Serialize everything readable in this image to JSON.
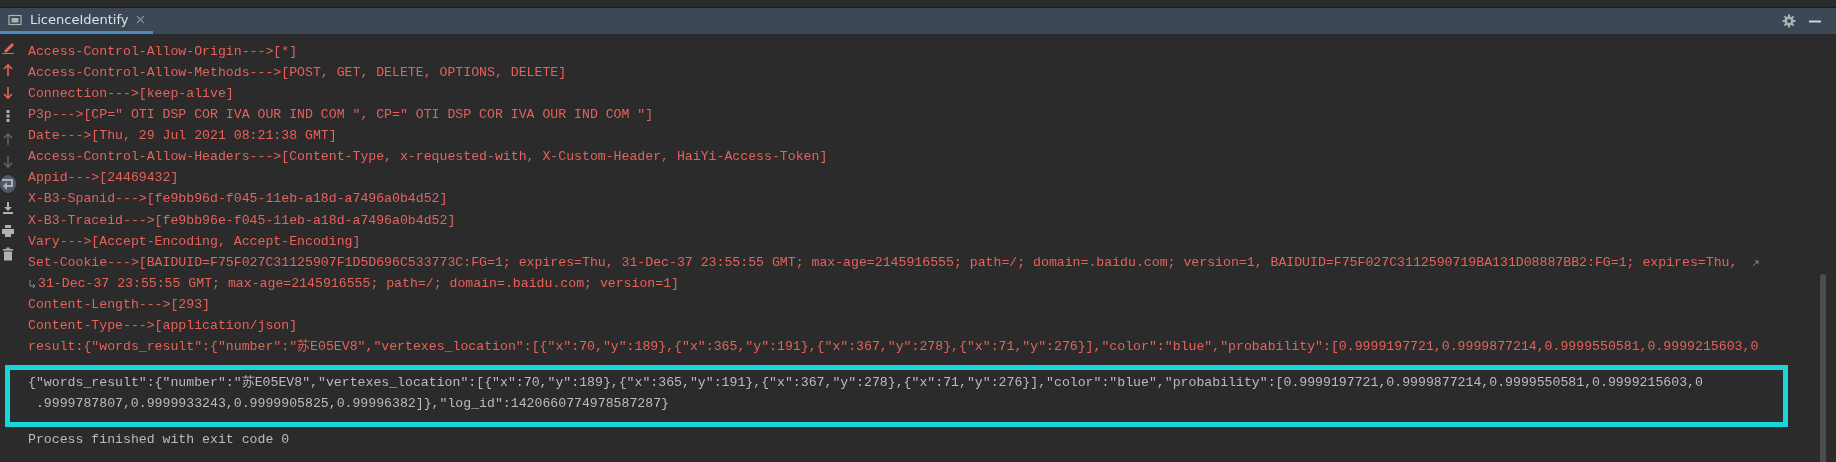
{
  "tab": {
    "title": "LicenceIdentify",
    "selected": true
  },
  "tab_actions": [
    {
      "kind": "settings"
    },
    {
      "kind": "minimize"
    }
  ],
  "toolbar": [
    {
      "kind": "pencil",
      "color": "#e8615a",
      "selected": false
    },
    {
      "kind": "arrow-up",
      "color": "#e8615a",
      "selected": false
    },
    {
      "kind": "arrow-down",
      "color": "#e8615a",
      "selected": false
    },
    {
      "kind": "dots",
      "color": "#afb1b3",
      "selected": false
    },
    {
      "kind": "arrow-up",
      "color": "#5f6163",
      "selected": false
    },
    {
      "kind": "arrow-down",
      "color": "#5f6163",
      "selected": false
    },
    {
      "kind": "wrap",
      "color": "#afb1b3",
      "selected": true
    },
    {
      "kind": "scroll-end",
      "color": "#afb1b3",
      "selected": false
    },
    {
      "kind": "print",
      "color": "#afb1b3",
      "selected": false
    },
    {
      "kind": "trash",
      "color": "#afb1b3",
      "selected": false
    }
  ],
  "console_lines": [
    {
      "kind": "error",
      "text": "Access-Control-Allow-Origin--->[*]"
    },
    {
      "kind": "error",
      "text": "Access-Control-Allow-Methods--->[POST, GET, DELETE, OPTIONS, DELETE]"
    },
    {
      "kind": "error",
      "text": "Connection--->[keep-alive]"
    },
    {
      "kind": "error",
      "text": "P3p--->[CP=\" OTI DSP COR IVA OUR IND COM \", CP=\" OTI DSP COR IVA OUR IND COM \"]"
    },
    {
      "kind": "error",
      "text": "Date--->[Thu, 29 Jul 2021 08:21:38 GMT]"
    },
    {
      "kind": "error",
      "text": "Access-Control-Allow-Headers--->[Content-Type, x-requested-with, X-Custom-Header, HaiYi-Access-Token]"
    },
    {
      "kind": "error",
      "text": "Appid--->[24469432]"
    },
    {
      "kind": "error",
      "text": "X-B3-Spanid--->[fe9bb96d-f045-11eb-a18d-a7496a0b4d52]"
    },
    {
      "kind": "error",
      "text": "X-B3-Traceid--->[fe9bb96e-f045-11eb-a18d-a7496a0b4d52]"
    },
    {
      "kind": "error",
      "text": "Vary--->[Accept-Encoding, Accept-Encoding]"
    },
    {
      "kind": "error-wrapped",
      "text": "Set-Cookie--->[BAIDUID=F75F027C31125907F1D5D696C533773C:FG=1; expires=Thu, 31-Dec-37 23:55:55 GMT; max-age=2145916555; path=/; domain=.baidu.com; version=1, BAIDUID=F75F027C3112590719BA131D08887BB2:FG=1; expires=Thu,"
    },
    {
      "kind": "error-continued",
      "text": "31-Dec-37 23:55:55 GMT; max-age=2145916555; path=/; domain=.baidu.com; version=1]"
    },
    {
      "kind": "error",
      "text": "Content-Length--->[293]"
    },
    {
      "kind": "error",
      "text": "Content-Type--->[application/json]"
    },
    {
      "kind": "error",
      "text": "result:{\"words_result\":{\"number\":\"苏E05EV8\",\"vertexes_location\":[{\"x\":70,\"y\":189},{\"x\":365,\"y\":191},{\"x\":367,\"y\":278},{\"x\":71,\"y\":276}],\"color\":\"blue\",\"probability\":[0.9999197721,0.9999877214,0.9999550581,0.9999215603,0"
    }
  ],
  "highlight_box": {
    "lines": [
      {
        "kind": "output",
        "text": "{\"words_result\":{\"number\":\"苏E05EV8\",\"vertexes_location\":[{\"x\":70,\"y\":189},{\"x\":365,\"y\":191},{\"x\":367,\"y\":278},{\"x\":71,\"y\":276}],\"color\":\"blue\",\"probability\":[0.9999197721,0.9999877214,0.9999550581,0.9999215603,0"
      },
      {
        "kind": "output-continued",
        "text": ".9999787807,0.9999933243,0.9999905825,0.99996382]},\"log_id\":1420660774978587287}"
      }
    ]
  },
  "exit_message": {
    "kind": "output",
    "text": "Process finished with exit code 0"
  }
}
